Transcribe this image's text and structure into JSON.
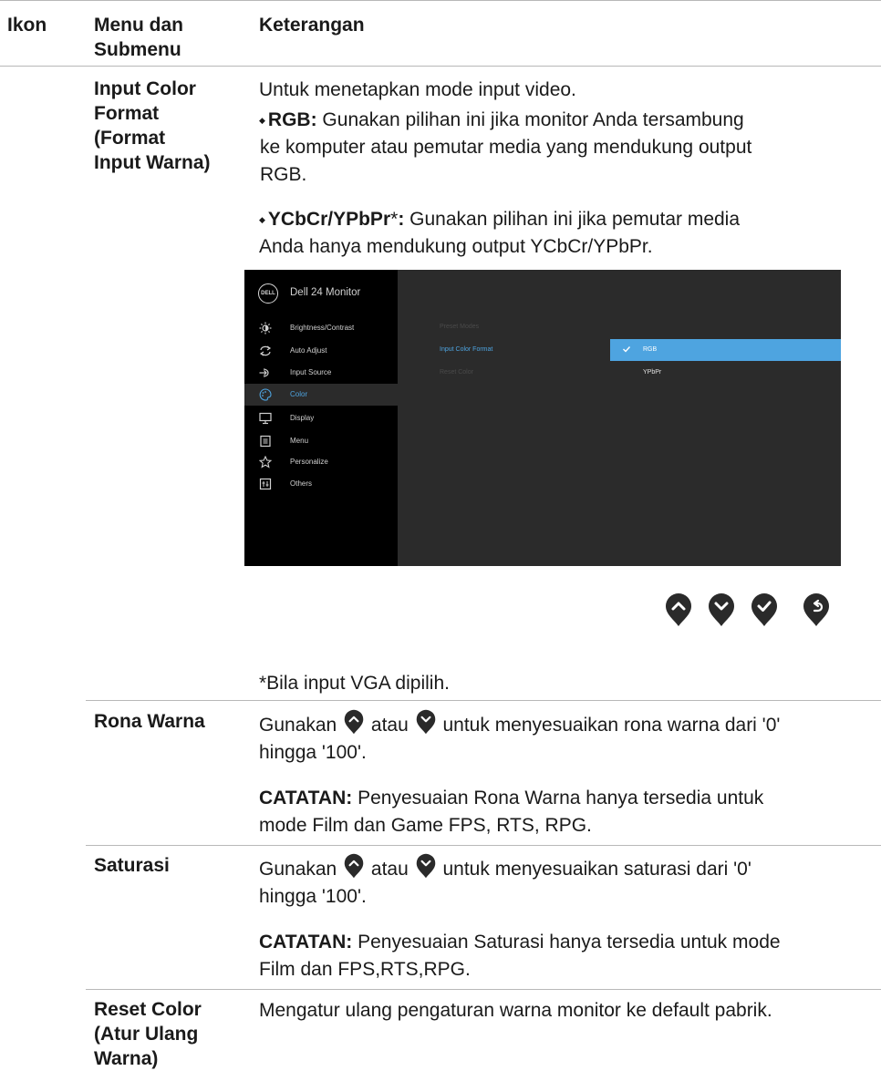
{
  "header": {
    "col_icon": "Ikon",
    "col_menu_line1": "Menu dan",
    "col_menu_line2": "Submenu",
    "col_desc": "Keterangan"
  },
  "input_color_format": {
    "name_lines": [
      "Input Color",
      "Format",
      "(Format",
      "Input Warna)"
    ],
    "intro": "Untuk menetapkan mode input video.",
    "rgb_label": "RGB:",
    "rgb_lines": [
      " Gunakan pilihan ini jika monitor Anda tersambung",
      "ke komputer atau pemutar media yang mendukung output",
      "RGB."
    ],
    "ycbcr_label": "YCbCr/YPbPr",
    "ycbcr_star": "*",
    "ycbcr_colon": ":",
    "ycbcr_lines": [
      " Gunakan pilihan ini jika pemutar media",
      "Anda hanya mendukung output YCbCr/YPbPr."
    ],
    "footnote": "*Bila input VGA dipilih."
  },
  "osd": {
    "logo": "DELL",
    "title": "Dell 24 Monitor",
    "menu_items": [
      {
        "label": "Brightness/Contrast",
        "icon": "brightness-icon",
        "selected": false
      },
      {
        "label": "Auto Adjust",
        "icon": "auto-adjust-icon",
        "selected": false
      },
      {
        "label": "Input Source",
        "icon": "input-source-icon",
        "selected": false
      },
      {
        "label": "Color",
        "icon": "color-palette-icon",
        "selected": true
      },
      {
        "label": "Display",
        "icon": "display-icon",
        "selected": false
      },
      {
        "label": "Menu",
        "icon": "menu-icon",
        "selected": false
      },
      {
        "label": "Personalize",
        "icon": "star-icon",
        "selected": false
      },
      {
        "label": "Others",
        "icon": "others-icon",
        "selected": false
      }
    ],
    "submenu": [
      "Preset Modes",
      "Input Color Format",
      "Reset Color"
    ],
    "active_submenu": "Input Color Format",
    "options": [
      {
        "label": "RGB",
        "selected": true
      },
      {
        "label": "YPbPr",
        "selected": false
      }
    ],
    "accent_color": "#4ea4e0"
  },
  "nav_buttons": [
    "up-icon",
    "down-icon",
    "check-icon",
    "back-icon"
  ],
  "hue": {
    "name": "Rona Warna",
    "p1_a": "Gunakan",
    "p1_b": "atau",
    "p1_c": "untuk menyesuaikan rona warna dari '0'",
    "p1_line2": "hingga '100'.",
    "note_label": "CATATAN:",
    "note_line1": " Penyesuaian Rona Warna hanya tersedia untuk",
    "note_line2": "mode Film dan Game FPS, RTS, RPG."
  },
  "saturation": {
    "name": "Saturasi",
    "p1_a": "Gunakan",
    "p1_b": "atau",
    "p1_c": "untuk menyesuaikan saturasi dari '0'",
    "p1_line2": "hingga '100'.",
    "note_label": "CATATAN:",
    "note_line1": " Penyesuaian Saturasi hanya tersedia untuk mode",
    "note_line2": "Film dan FPS,RTS,RPG."
  },
  "reset_color": {
    "name_lines": [
      "Reset Color",
      "(Atur Ulang",
      "Warna)"
    ],
    "desc": "Mengatur ulang pengaturan warna monitor ke default pabrik."
  }
}
